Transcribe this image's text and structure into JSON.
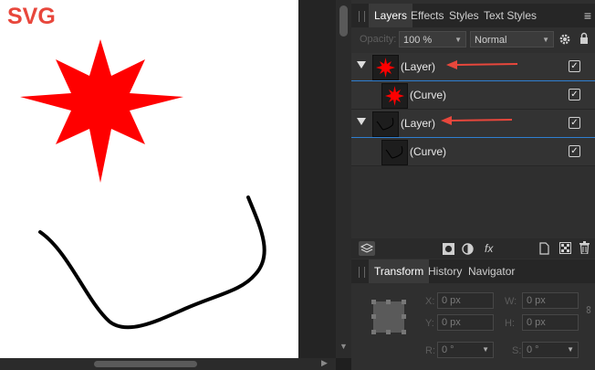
{
  "canvas": {
    "label": "SVG",
    "star_color": "#ff0000",
    "curve_color": "#000000"
  },
  "panel": {
    "tabs": [
      "Layers",
      "Effects",
      "Styles",
      "Text Styles"
    ],
    "active_tab": "Layers",
    "opacity_label": "Opacity:",
    "opacity_value": "100 %",
    "blend_mode": "Normal",
    "layers": [
      {
        "label": "(Layer)",
        "level": 0,
        "icon": "star-thumbnail-icon",
        "visible": true
      },
      {
        "label": "(Curve)",
        "level": 1,
        "icon": "star-thumbnail-icon",
        "visible": true
      },
      {
        "label": "(Layer)",
        "level": 0,
        "icon": "curve-thumbnail-icon",
        "visible": true
      },
      {
        "label": "(Curve)",
        "level": 1,
        "icon": "curve-thumbnail-icon",
        "visible": true
      }
    ],
    "annotation_arrow_color": "#e8473c",
    "fx_label": "fx"
  },
  "transform": {
    "tabs": [
      "Transform",
      "History",
      "Navigator"
    ],
    "active_tab": "Transform",
    "x_label": "X:",
    "x_value": "0 px",
    "y_label": "Y:",
    "y_value": "0 px",
    "w_label": "W:",
    "w_value": "0 px",
    "h_label": "H:",
    "h_value": "0 px",
    "r_label": "R:",
    "r_value": "0 °",
    "s_label": "S:",
    "s_value": "0 °"
  }
}
